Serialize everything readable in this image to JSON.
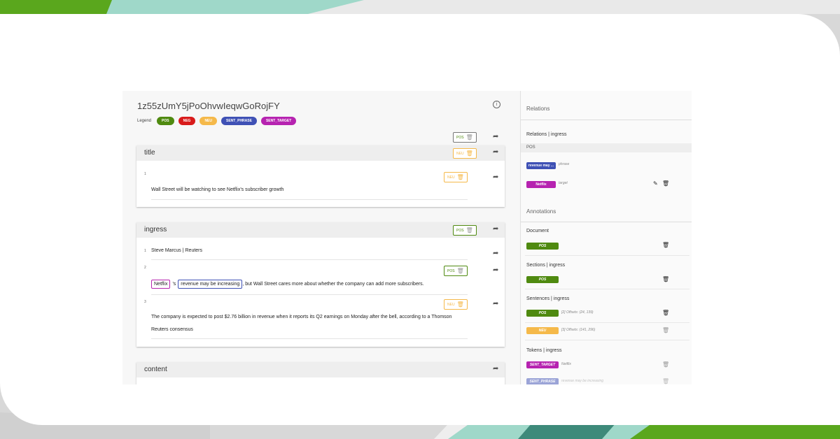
{
  "document": {
    "id": "1z55zUmY5jPoOhvwIeqwGoRojFY"
  },
  "legend": {
    "label": "Legend",
    "items": [
      {
        "label": "POS",
        "color": "#4f8a10"
      },
      {
        "label": "NEG",
        "color": "#d81b1b"
      },
      {
        "label": "NEU",
        "color": "#f5b94a"
      },
      {
        "label": "SENT_PHRASE",
        "color": "#3f51b5"
      },
      {
        "label": "SENT_TARGET",
        "color": "#b623b0"
      }
    ]
  },
  "top_tag": "POS",
  "sections": [
    {
      "title": "title",
      "tag": "NEU",
      "lines": [
        {
          "num": "1",
          "tag": "NEU",
          "text": "Wall Street will be watching to see Netflix's subscriber growth"
        }
      ]
    },
    {
      "title": "ingress",
      "tag": "POS",
      "lines": [
        {
          "num": "1",
          "text": "Steve Marcus | Reuters"
        },
        {
          "num": "2",
          "tag": "POS",
          "ent1": "Netflix",
          "mid": "'s",
          "ent2": "revenue may be increasing",
          "rest": ", but Wall Street cares more about whether the company can add more subscribers."
        },
        {
          "num": "3",
          "tag": "NEU",
          "text": "The company is expected to post $2.76 billion in revenue when it reports its Q2 earnings on Monday after the bell, according to a Thomson",
          "text2": "Reuters consensus"
        }
      ]
    },
    {
      "title": "content"
    }
  ],
  "sidebar": {
    "relations_title": "Relations",
    "relations_sub": "Relations | ingress",
    "relation_type": "POS",
    "relation_rows": [
      {
        "tag": "revenue may ...",
        "role": "phrase"
      },
      {
        "tag": "Netflix",
        "role": "target"
      }
    ],
    "annotations_title": "Annotations",
    "document_label": "Document",
    "document_tag": "POS",
    "sections_label": "Sections | ingress",
    "sections_tag": "POS",
    "sentences_label": "Sentences | ingress",
    "sentence_rows": [
      {
        "tag": "POS",
        "text": "[2] Offsets: (24, 139)"
      },
      {
        "tag": "NEU",
        "text": "[3] Offsets: (141, 296)"
      }
    ],
    "tokens_label": "Tokens | ingress",
    "token_rows": [
      {
        "tag": "SENT_TARGET",
        "text": "Netflix"
      },
      {
        "tag": "SENT_PHRASE",
        "text": "revenue may be increasing"
      }
    ]
  }
}
